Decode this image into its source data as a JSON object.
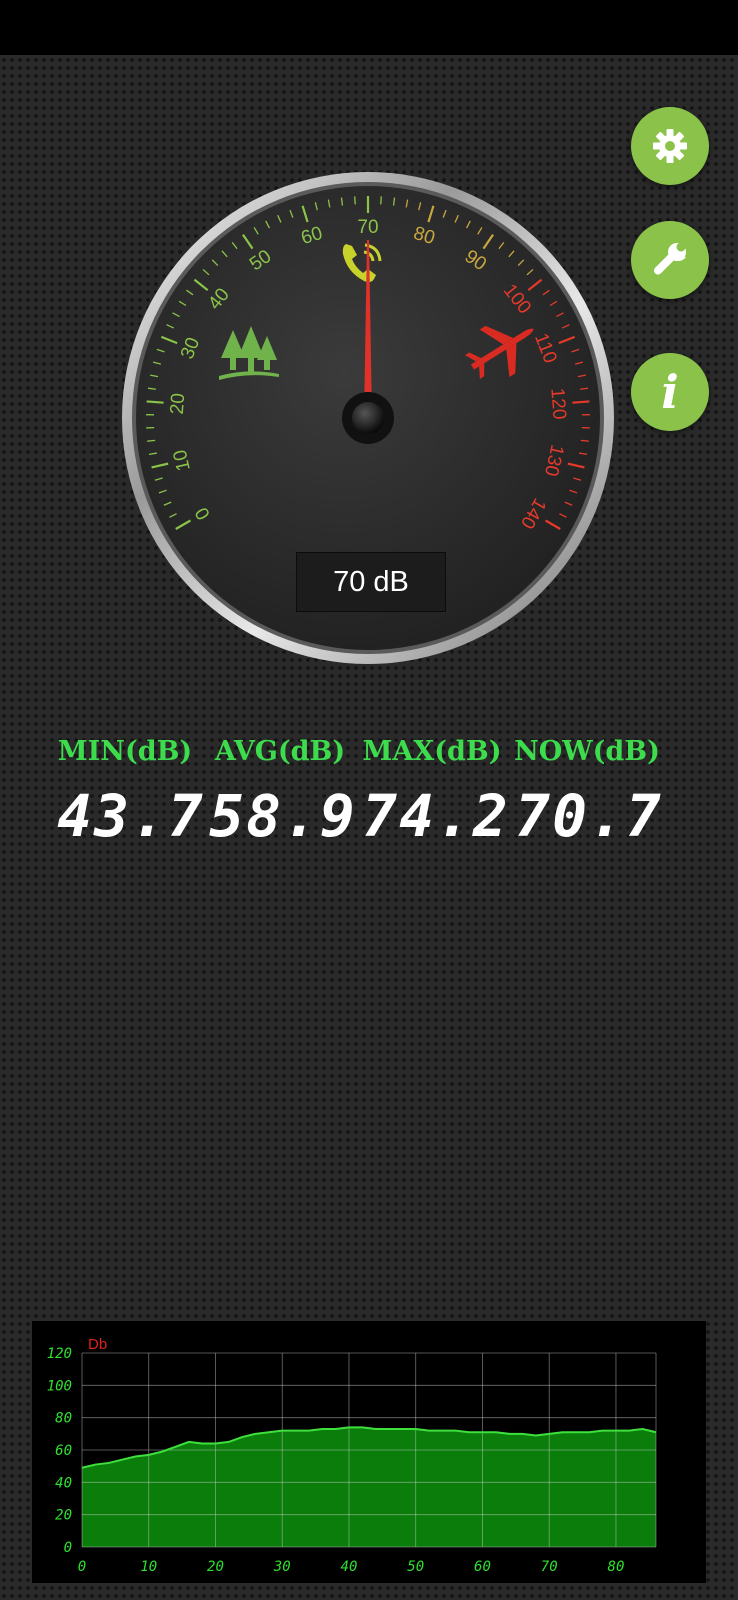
{
  "gauge": {
    "value": 70,
    "readout": "70 dB",
    "min": 0,
    "max": 140,
    "tick_labels": [
      "0",
      "10",
      "20",
      "30",
      "40",
      "50",
      "60",
      "70",
      "80",
      "90",
      "100",
      "110",
      "120",
      "130",
      "140"
    ],
    "icons": [
      "trees-icon",
      "phone-ringing-icon",
      "airplane-icon"
    ],
    "colors": {
      "low": "#8bc34a",
      "mid": "#c8a640",
      "high": "#e53a2a",
      "needle": "#e0322a"
    }
  },
  "buttons": {
    "settings": "gear-icon",
    "tools": "wrench-icon",
    "info": "i"
  },
  "stats": [
    {
      "label": "MIN(dB)",
      "value": "43.7"
    },
    {
      "label": "AVG(dB)",
      "value": "58.9"
    },
    {
      "label": "MAX(dB)",
      "value": "74.2"
    },
    {
      "label": "NOW(dB)",
      "value": "70.7"
    }
  ],
  "chart_data": {
    "type": "area",
    "ylabel": "Db",
    "xlabel": "",
    "ylim": [
      0,
      120
    ],
    "xlim": [
      0,
      86
    ],
    "yticks": [
      "0",
      "20",
      "40",
      "60",
      "80",
      "100",
      "120"
    ],
    "xticks": [
      "0",
      "10",
      "20",
      "30",
      "40",
      "50",
      "60",
      "70",
      "80"
    ],
    "grid": true,
    "series": [
      {
        "x": [
          0,
          2,
          4,
          6,
          8,
          10,
          12,
          14,
          16,
          18,
          20,
          22,
          24,
          26,
          28,
          30,
          32,
          34,
          36,
          38,
          40,
          42,
          44,
          46,
          48,
          50,
          52,
          54,
          56,
          58,
          60,
          62,
          64,
          66,
          68,
          70,
          72,
          74,
          76,
          78,
          80,
          82,
          84,
          86
        ],
        "values": [
          49,
          51,
          52,
          54,
          56,
          57,
          59,
          62,
          65,
          64,
          64,
          65,
          68,
          70,
          71,
          72,
          72,
          72,
          73,
          73,
          74,
          74,
          73,
          73,
          73,
          73,
          72,
          72,
          72,
          71,
          71,
          71,
          70,
          70,
          69,
          70,
          71,
          71,
          71,
          72,
          72,
          72,
          73,
          71
        ]
      }
    ],
    "colors": {
      "fill": "#0b7d0b",
      "line": "#3ee03e",
      "labels": "#2fe02f",
      "unit": "#e02020",
      "grid": "#cccccc"
    }
  }
}
